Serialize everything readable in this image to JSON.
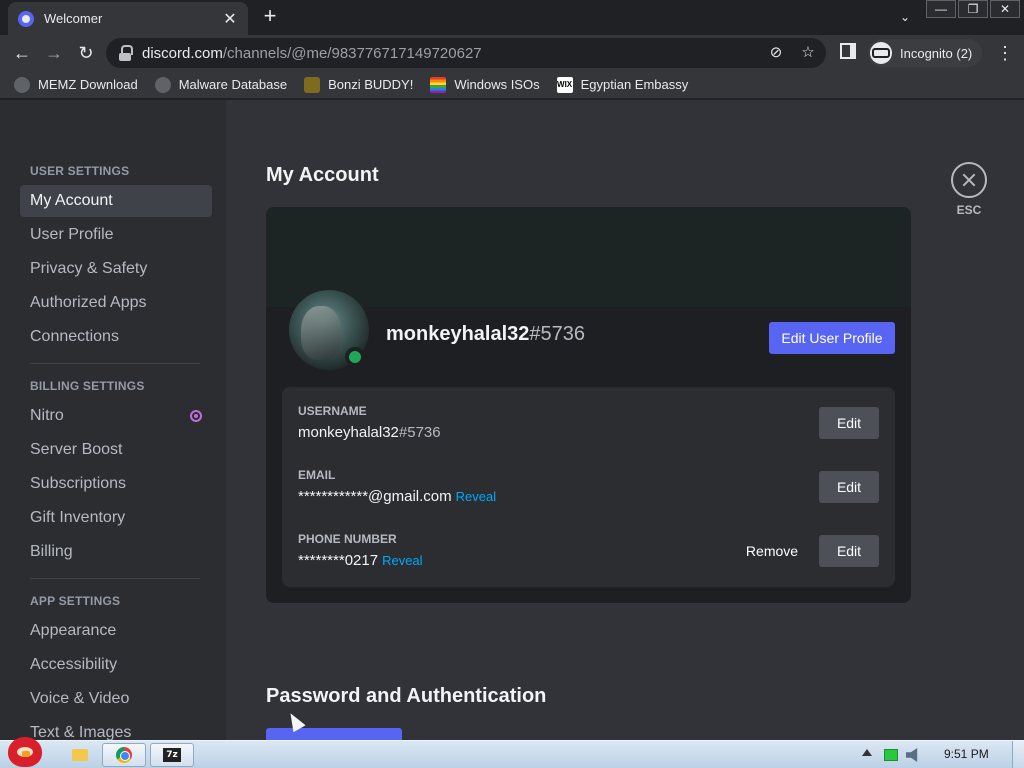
{
  "browser": {
    "tab": {
      "title": "Welcomer",
      "close": "✕"
    },
    "new_tab": "+",
    "tab_search": "⌄",
    "window_controls": {
      "minimize": "—",
      "restore": "❐",
      "close": "✕"
    },
    "nav": {
      "back": "←",
      "forward": "→",
      "reload": "↻"
    },
    "address": {
      "host": "discord.com",
      "path": "/channels/@me/983776717149720627"
    },
    "omnibox_icons": {
      "eye_off": "⊘",
      "star": "☆"
    },
    "profile_label": "Incognito (2)",
    "menu": "⋮",
    "bookmarks": [
      {
        "label": "MEMZ Download",
        "icon": "globe-icon"
      },
      {
        "label": "Malware Database",
        "icon": "globe-icon"
      },
      {
        "label": "Bonzi BUDDY!",
        "icon": "bonzi-icon"
      },
      {
        "label": "Windows ISOs",
        "icon": "rainbow-flag-icon"
      },
      {
        "label": "Egyptian Embassy",
        "icon": "wix-icon",
        "icon_text": "WIX"
      }
    ]
  },
  "sidebar": {
    "user_settings_heading": "USER SETTINGS",
    "user_items": [
      "My Account",
      "User Profile",
      "Privacy & Safety",
      "Authorized Apps",
      "Connections"
    ],
    "billing_heading": "BILLING SETTINGS",
    "billing_items": [
      "Nitro",
      "Server Boost",
      "Subscriptions",
      "Gift Inventory",
      "Billing"
    ],
    "app_heading": "APP SETTINGS",
    "app_items": [
      "Appearance",
      "Accessibility",
      "Voice & Video",
      "Text & Images"
    ],
    "active_item": "My Account"
  },
  "main": {
    "title": "My Account",
    "esc_label": "ESC",
    "profile": {
      "username": "monkeyhalal32",
      "discriminator": "#5736",
      "status": "online",
      "status_color": "#23a55a"
    },
    "edit_profile_button": "Edit User Profile",
    "fields": {
      "username_label": "USERNAME",
      "username_value": "monkeyhalal32",
      "username_disc": "#5736",
      "email_label": "EMAIL",
      "email_value": "************@gmail.com",
      "phone_label": "PHONE NUMBER",
      "phone_value": "********0217",
      "reveal": "Reveal",
      "edit": "Edit",
      "remove": "Remove"
    },
    "password_section_title": "Password and Authentication"
  },
  "taskbar": {
    "clock": "9:51 PM",
    "apps": [
      "explorer-icon",
      "chrome-icon",
      "7zip-icon"
    ],
    "seven_zip_label": "7z"
  },
  "colors": {
    "accent": "#5865f2",
    "link": "#00a8fc",
    "sidebar_bg": "#2b2d31",
    "content_bg": "#313338"
  }
}
